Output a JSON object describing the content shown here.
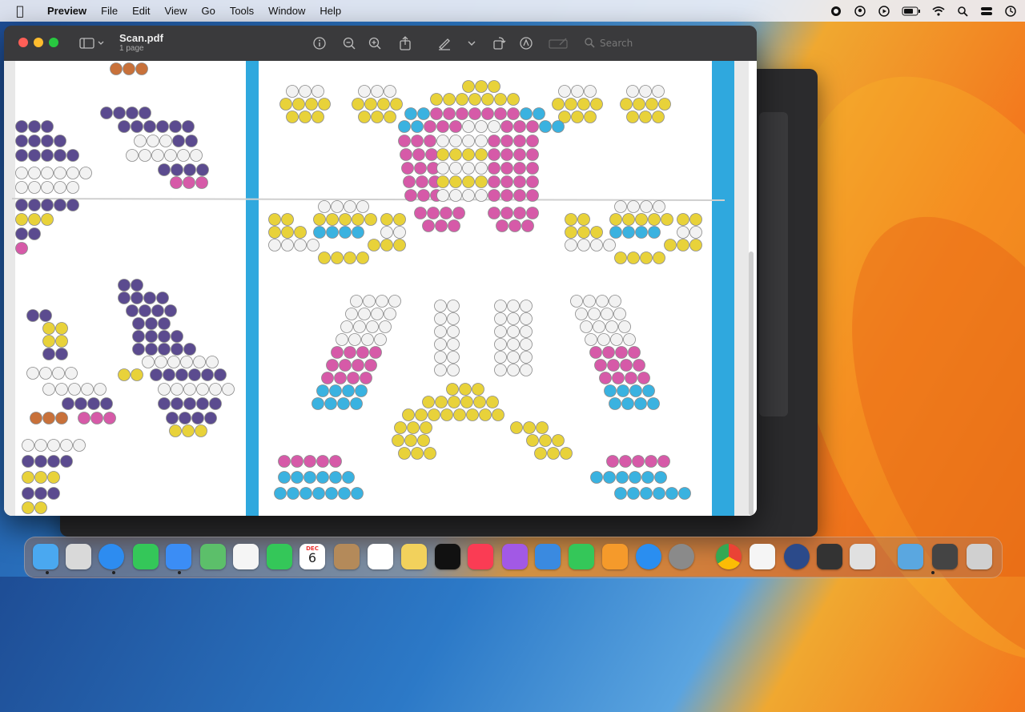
{
  "menubar": {
    "items": [
      "Preview",
      "File",
      "Edit",
      "View",
      "Go",
      "Tools",
      "Window",
      "Help"
    ]
  },
  "window": {
    "title": "Scan.pdf",
    "subtitle": "1 page",
    "search_placeholder": "Search"
  },
  "calendar": {
    "month": "DEC",
    "day": "6"
  },
  "colors": {
    "pink": "#d65aa8",
    "yellow": "#e8d23a",
    "blue": "#3ab2e0",
    "purple": "#5b4b8f",
    "white_bead": "#f2f2f2",
    "orange": "#c8713a",
    "bar": "#2fa8de"
  },
  "dock": {
    "icons": [
      "finder-icon",
      "launchpad-icon",
      "safari-icon",
      "messages-icon",
      "mail-icon",
      "maps-icon",
      "photos-icon",
      "facetime-icon",
      "calendar-icon",
      "contacts-icon",
      "reminders-icon",
      "notes-icon",
      "appletv-icon",
      "music-icon",
      "podcasts-icon",
      "keynote-icon",
      "numbers-icon",
      "pages-icon",
      "appstore-icon",
      "settings-icon",
      "chrome-icon",
      "textedit-icon",
      "quicktime-icon",
      "drive-icon",
      "preview-icon",
      "downloads-icon",
      "scanner-icon",
      "trash-icon"
    ]
  }
}
